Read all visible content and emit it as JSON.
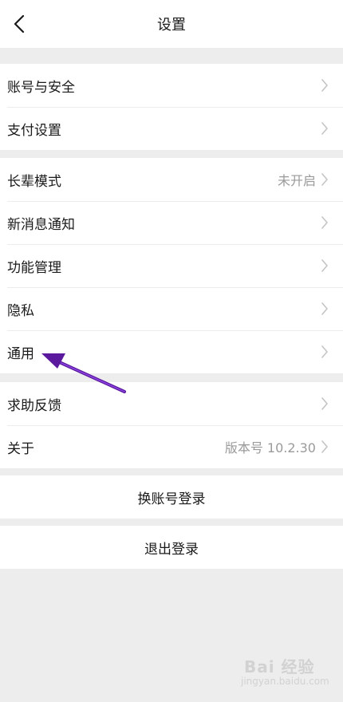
{
  "header": {
    "title": "设置",
    "back_icon": "chevron-left-icon"
  },
  "groups": [
    {
      "items": [
        {
          "label": "账号与安全",
          "value": ""
        },
        {
          "label": "支付设置",
          "value": ""
        }
      ]
    },
    {
      "items": [
        {
          "label": "长辈模式",
          "value": "未开启"
        },
        {
          "label": "新消息通知",
          "value": ""
        },
        {
          "label": "功能管理",
          "value": ""
        },
        {
          "label": "隐私",
          "value": ""
        },
        {
          "label": "通用",
          "value": ""
        }
      ]
    },
    {
      "items": [
        {
          "label": "求助反馈",
          "value": ""
        },
        {
          "label": "关于",
          "value": "版本号 10.2.30"
        }
      ]
    }
  ],
  "actions": {
    "switch_account": "换账号登录",
    "logout": "退出登录"
  },
  "annotation": {
    "arrow_color": "#6a1fb3",
    "target": "通用"
  },
  "watermark": {
    "text": "Bai 经验",
    "sub": "jingyan.baidu.com"
  },
  "colors": {
    "background": "#ededed",
    "card": "#ffffff",
    "text": "#1a1a1a",
    "secondary": "#9a9a9a"
  }
}
